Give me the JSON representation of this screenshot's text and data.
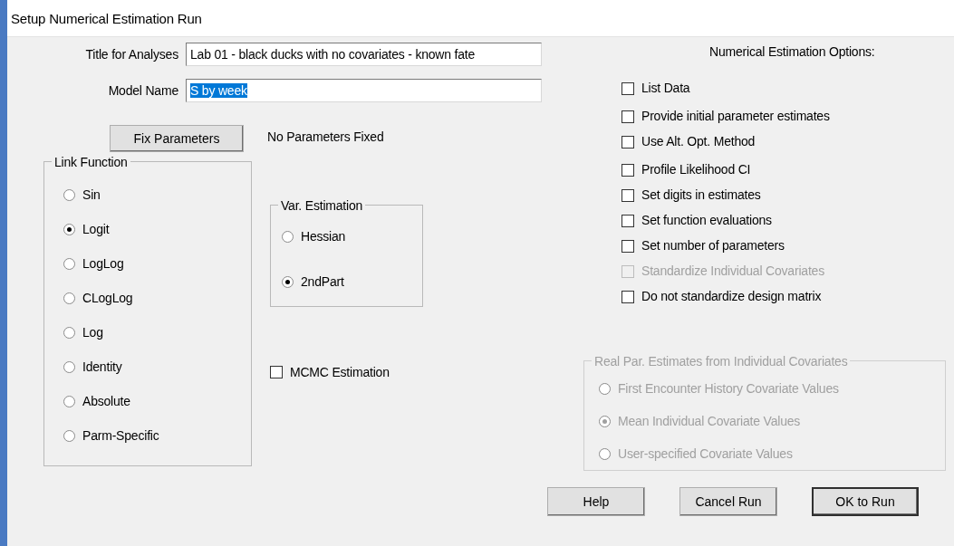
{
  "window": {
    "title": "Setup Numerical Estimation Run"
  },
  "fields": [
    {
      "label": "Title for Analyses",
      "value": "Lab 01 - black ducks with no covariates - known fate",
      "text_selected": false
    },
    {
      "label": "Model Name",
      "value": "S by week",
      "text_selected": true
    }
  ],
  "fix_parameters": {
    "button": "Fix Parameters",
    "status": "No Parameters Fixed"
  },
  "link_function": {
    "title": "Link Function",
    "options": [
      {
        "label": "Sin",
        "selected": false
      },
      {
        "label": "Logit",
        "selected": true
      },
      {
        "label": "LogLog",
        "selected": false
      },
      {
        "label": "CLogLog",
        "selected": false
      },
      {
        "label": "Log",
        "selected": false
      },
      {
        "label": "Identity",
        "selected": false
      },
      {
        "label": "Absolute",
        "selected": false
      },
      {
        "label": "Parm-Specific",
        "selected": false
      }
    ]
  },
  "var_estimation": {
    "title": "Var. Estimation",
    "options": [
      {
        "label": "Hessian",
        "selected": false
      },
      {
        "label": "2ndPart",
        "selected": true
      }
    ]
  },
  "mcmc": {
    "label": "MCMC Estimation",
    "checked": false
  },
  "options": {
    "title": "Numerical Estimation Options:",
    "items": [
      {
        "label": "List Data",
        "checked": false,
        "disabled": false
      },
      {
        "label": "Provide initial parameter estimates",
        "checked": false,
        "disabled": false
      },
      {
        "label": "Use Alt. Opt. Method",
        "checked": false,
        "disabled": false
      },
      {
        "label": "Profile Likelihood CI",
        "checked": false,
        "disabled": false
      },
      {
        "label": "Set digits in estimates",
        "checked": false,
        "disabled": false
      },
      {
        "label": "Set function evaluations",
        "checked": false,
        "disabled": false
      },
      {
        "label": "Set number of parameters",
        "checked": false,
        "disabled": false
      },
      {
        "label": "Standardize Individual Covariates",
        "checked": false,
        "disabled": true
      },
      {
        "label": "Do not standardize design matrix",
        "checked": false,
        "disabled": false
      }
    ]
  },
  "covariates": {
    "title": "Real Par. Estimates from Individual Covariates",
    "disabled": true,
    "options": [
      {
        "label": "First Encounter History Covariate Values",
        "selected": false
      },
      {
        "label": "Mean Individual Covariate Values",
        "selected": true
      },
      {
        "label": "User-specified Covariate Values",
        "selected": false
      }
    ]
  },
  "buttons": [
    {
      "label": "Help",
      "default": false
    },
    {
      "label": "Cancel Run",
      "default": false
    },
    {
      "label": "OK to Run",
      "default": true
    }
  ]
}
